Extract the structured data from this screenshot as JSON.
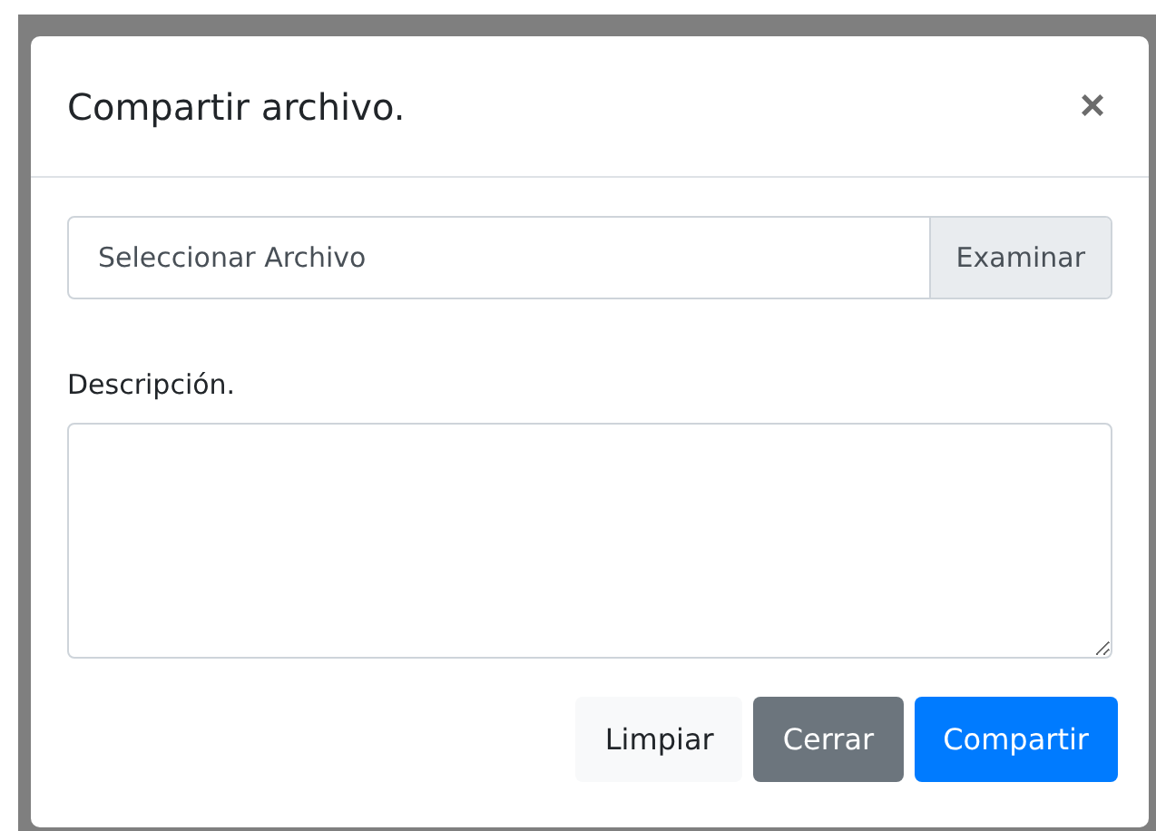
{
  "modal": {
    "title": "Compartir archivo.",
    "close": "×"
  },
  "file_input": {
    "placeholder": "Seleccionar Archivo",
    "button": "Examinar"
  },
  "description": {
    "label": "Descripción."
  },
  "buttons": [
    {
      "label": "Limpiar",
      "kind": "light"
    },
    {
      "label": "Cerrar",
      "kind": "secondary"
    },
    {
      "label": "Compartir",
      "kind": "primary"
    }
  ]
}
